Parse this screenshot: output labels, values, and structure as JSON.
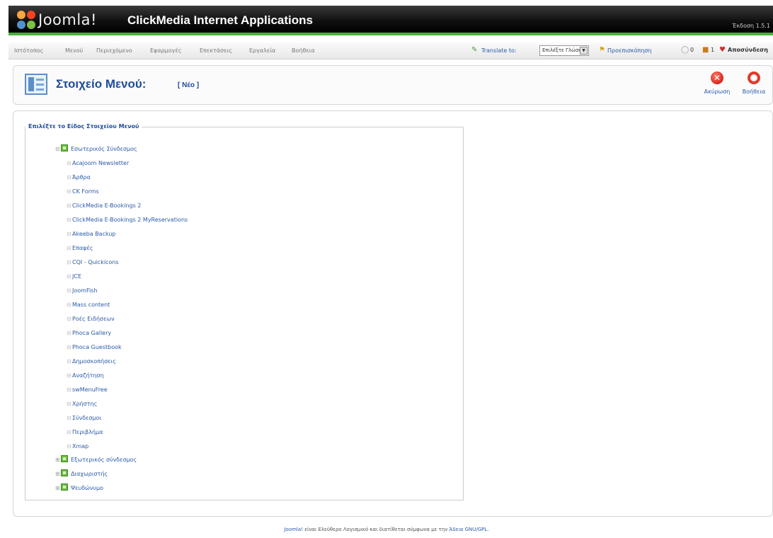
{
  "header": {
    "logo_text": "Joomla!",
    "site_name": "ClickMedia Internet Applications",
    "version": "Έκδοση 1.5.1"
  },
  "menu": {
    "items": [
      "Ιστότοπος",
      "Μενού",
      "Περιεχόμενο",
      "Εφαρμογές",
      "Επεκτάσεις",
      "Εργαλεία",
      "Βοήθεια"
    ],
    "translate_label": "Translate to:",
    "language_select": "Επιλέξτε Γλώσσα",
    "preview": "Προεπισκόπηση",
    "messages_count": "0",
    "users_count": "1",
    "logout": "Αποσύνδεση"
  },
  "title_bar": {
    "title": "Στοιχείο Μενού:",
    "subtitle": "[ Νέο ]",
    "cancel_label": "Ακύρωση",
    "help_label": "Βοήθεια"
  },
  "tree": {
    "legend": "Επιλέξτε το Είδος Στοιχείου Μενού",
    "root": "Εσωτερικός Σύνδεσμος",
    "children": [
      "Acajoom Newsletter",
      "Άρθρα",
      "CK Forms",
      "ClickMedia E-Bookings 2",
      "ClickMedia E-Bookings 2 MyReservations",
      "Akeeba Backup",
      "Επαφές",
      "CQI - Quickicons",
      "JCE",
      "JoomFish",
      "Mass content",
      "Ροές Ειδήσεων",
      "Phoca Gallery",
      "Phoca Guestbook",
      "Δημοσκοπήσεις",
      "Αναζήτηση",
      "swMenuFree",
      "Χρήστης",
      "Σύνδεσμοι",
      "Περιβλήμα",
      "Xmap"
    ],
    "bottom": [
      "Εξωτερικός σύνδεσμος",
      "Διαχωριστής",
      "Ψευδώνυμο"
    ]
  },
  "footer": {
    "link": "Joomla!",
    "text": "είναι Ελεύθερο Λογισμικό και διατίθεται σύμφωνα με την",
    "license": "Άδεια GNU/GPL."
  }
}
